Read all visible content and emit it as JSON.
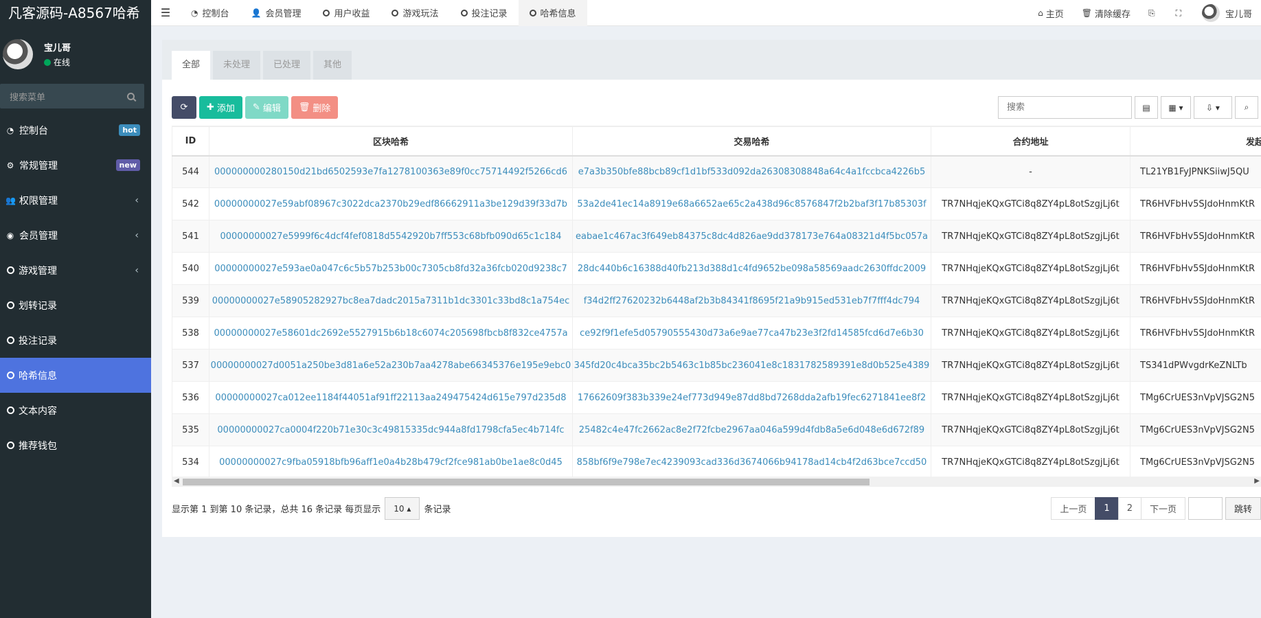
{
  "brand": "凡客源码-A8567哈希",
  "user": {
    "name": "宝儿哥",
    "status": "在线"
  },
  "sidebar": {
    "search_placeholder": "搜索菜单",
    "items": [
      {
        "label": "控制台",
        "icon": "dashboard-icon",
        "badge": "hot"
      },
      {
        "label": "常规管理",
        "icon": "cogs-icon",
        "badge": "new"
      },
      {
        "label": "权限管理",
        "icon": "group-icon",
        "chevron": true
      },
      {
        "label": "会员管理",
        "icon": "user-circle-icon",
        "chevron": true
      },
      {
        "label": "游戏管理",
        "icon": "circle-icon",
        "chevron": true
      },
      {
        "label": "划转记录",
        "icon": "circle-icon"
      },
      {
        "label": "投注记录",
        "icon": "circle-icon"
      },
      {
        "label": "哈希信息",
        "icon": "circle-icon",
        "active": true
      },
      {
        "label": "文本内容",
        "icon": "circle-icon"
      },
      {
        "label": "推荐钱包",
        "icon": "circle-icon"
      }
    ]
  },
  "topnav": {
    "tabs": [
      {
        "label": "控制台",
        "icon": "dashboard-icon"
      },
      {
        "label": "会员管理",
        "icon": "user-icon"
      },
      {
        "label": "用户收益",
        "icon": "circle-icon"
      },
      {
        "label": "游戏玩法",
        "icon": "circle-icon"
      },
      {
        "label": "投注记录",
        "icon": "circle-icon"
      },
      {
        "label": "哈希信息",
        "icon": "circle-icon",
        "active": true
      }
    ],
    "home": "主页",
    "clear_cache": "清除缓存",
    "username": "宝儿哥"
  },
  "subtabs": [
    "全部",
    "未处理",
    "已处理",
    "其他"
  ],
  "toolbar": {
    "add": "添加",
    "edit": "编辑",
    "delete": "删除",
    "search_placeholder": "搜索"
  },
  "table": {
    "columns": [
      "ID",
      "区块哈希",
      "交易哈希",
      "合约地址",
      "发起地址"
    ],
    "rows": [
      [
        "544",
        "000000000280150d21bd6502593e7fa1278100363e89f0cc75714492f5266cd6",
        "e7a3b350bfe88bcb89cf1d1bf533d092da26308308848a64c4a1fccbca4226b5",
        "-",
        "TL21YB1FyJPNKSiiwJ5QU"
      ],
      [
        "542",
        "00000000027e59abf08967c3022dca2370b29edf86662911a3be129d39f33d7b",
        "53a2de41ec14a8919e68a6652ae65c2a438d96c8576847f2b2baf3f17b85303f",
        "TR7NHqjeKQxGTCi8q8ZY4pL8otSzgjLj6t",
        "TR6HVFbHv5SJdoHnmKtR"
      ],
      [
        "541",
        "00000000027e5999f6c4dcf4fef0818d5542920b7ff553c68bfb090d65c1c184",
        "eabae1c467ac3f649eb84375c8dc4d826ae9dd378173e764a08321d4f5bc057a",
        "TR7NHqjeKQxGTCi8q8ZY4pL8otSzgjLj6t",
        "TR6HVFbHv5SJdoHnmKtR"
      ],
      [
        "540",
        "00000000027e593ae0a047c6c5b57b253b00c7305cb8fd32a36fcb020d9238c7",
        "28dc440b6c16388d40fb213d388d1c4fd9652be098a58569aadc2630ffdc2009",
        "TR7NHqjeKQxGTCi8q8ZY4pL8otSzgjLj6t",
        "TR6HVFbHv5SJdoHnmKtR"
      ],
      [
        "539",
        "00000000027e58905282927bc8ea7dadc2015a7311b1dc3301c33bd8c1a754ec",
        "f34d2ff27620232b6448af2b3b84341f8695f21a9b915ed531eb7f7fff4dc794",
        "TR7NHqjeKQxGTCi8q8ZY4pL8otSzgjLj6t",
        "TR6HVFbHv5SJdoHnmKtR"
      ],
      [
        "538",
        "00000000027e58601dc2692e5527915b6b18c6074c205698fbcb8f832ce4757a",
        "ce92f9f1efe5d05790555430d73a6e9ae77ca47b23e3f2fd14585fcd6d7e6b30",
        "TR7NHqjeKQxGTCi8q8ZY4pL8otSzgjLj6t",
        "TR6HVFbHv5SJdoHnmKtR"
      ],
      [
        "537",
        "00000000027d0051a250be3d81a6e52a230b7aa4278abe66345376e195e9ebc0",
        "345fd20c4bca35bc2b5463c1b85bc236041e8c1831782589391e8d0b525e4389",
        "TR7NHqjeKQxGTCi8q8ZY4pL8otSzgjLj6t",
        "TS341dPWvgdrKeZNLTb"
      ],
      [
        "536",
        "00000000027ca012ee1184f44051af91ff22113aa249475424d615e797d235d8",
        "17662609f383b339e24ef773d949e87dd8bd7268dda2afb19fec6271841ee8f2",
        "TR7NHqjeKQxGTCi8q8ZY4pL8otSzgjLj6t",
        "TMg6CrUES3nVpVJSG2N5"
      ],
      [
        "535",
        "00000000027ca0004f220b71e30c3c49815335dc944a8fd1798cfa5ec4b714fc",
        "25482c4e47fc2662ac8e2f72fcbe2967aa046a599d4fdb8a5e6d048e6d672f89",
        "TR7NHqjeKQxGTCi8q8ZY4pL8otSzgjLj6t",
        "TMg6CrUES3nVpVJSG2N5"
      ],
      [
        "534",
        "00000000027c9fba05918bfb96aff1e0a4b28b479cf2fce981ab0be1ae8c0d45",
        "858bf6f9e798e7ec4239093cad336d3674066b94178ad14cb4f2d63bce7ccd50",
        "TR7NHqjeKQxGTCi8q8ZY4pL8otSzgjLj6t",
        "TMg6CrUES3nVpVJSG2N5"
      ]
    ]
  },
  "footer": {
    "info_prefix": "显示第 1 到第 10 条记录，总共 16 条记录 每页显示",
    "page_size": "10",
    "info_suffix": "条记录",
    "prev": "上一页",
    "pages": [
      "1",
      "2"
    ],
    "next": "下一页",
    "go": "跳转"
  },
  "colors": {
    "sidebar_bg": "#222d32",
    "active_menu": "#4e73df",
    "link": "#3c8dbc",
    "add_btn": "#18bc9c"
  }
}
